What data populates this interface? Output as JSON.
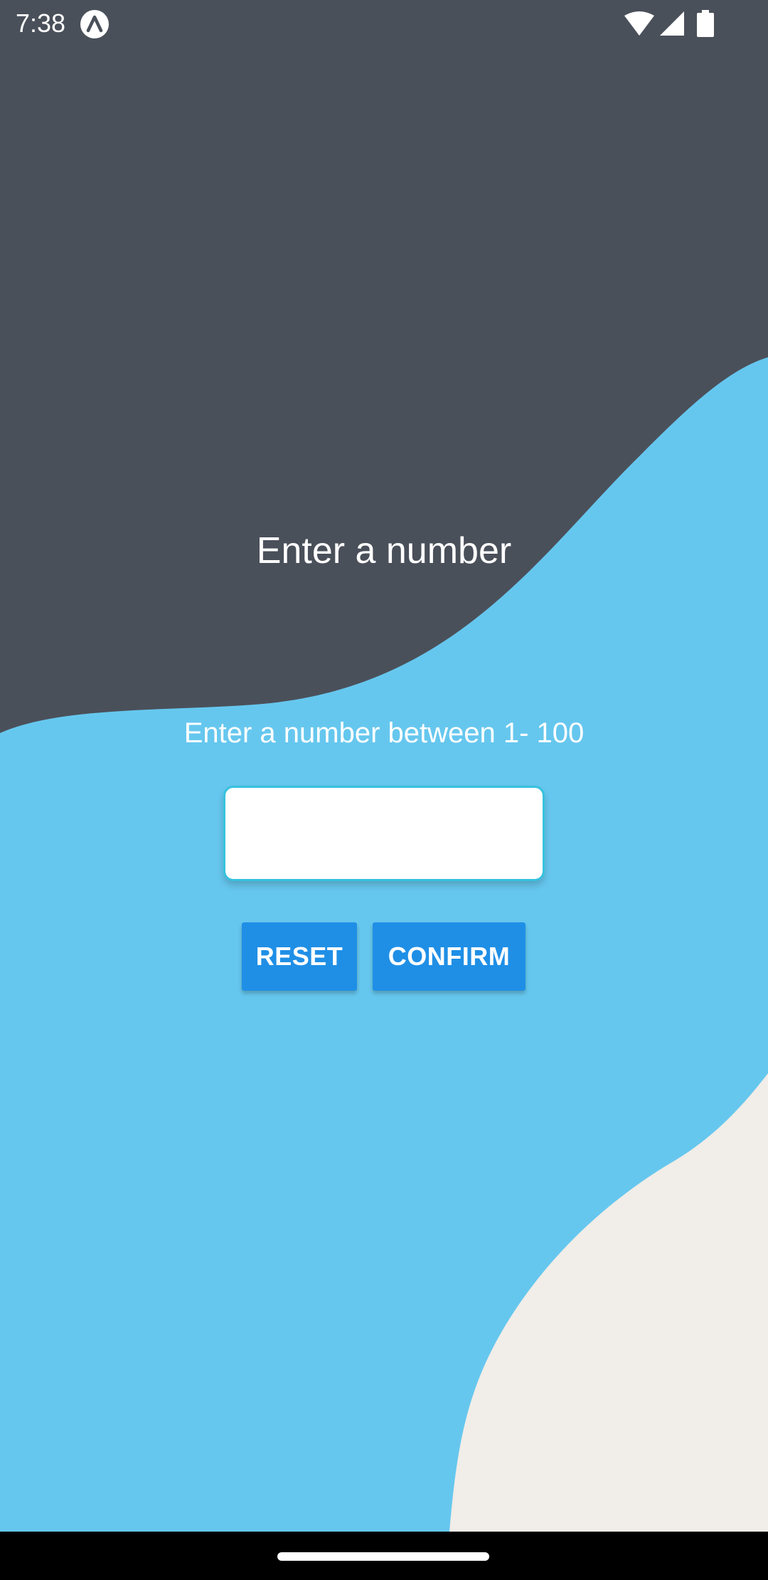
{
  "status_bar": {
    "time": "7:38",
    "app_icon": "app-logo-icon",
    "wifi_icon": "wifi-icon",
    "signal_icon": "cell-signal-icon",
    "battery_icon": "battery-icon"
  },
  "screen": {
    "title": "Enter a number",
    "subtitle": "Enter a number between 1- 100",
    "input": {
      "value": "",
      "placeholder": ""
    },
    "buttons": {
      "reset_label": "RESET",
      "confirm_label": "CONFIRM"
    }
  },
  "colors": {
    "dark_background": "#4a505a",
    "wave_blue": "#66c7ee",
    "wave_cream": "#f1ede8",
    "button_blue": "#1f8fe6",
    "input_border": "#35c2dd"
  }
}
